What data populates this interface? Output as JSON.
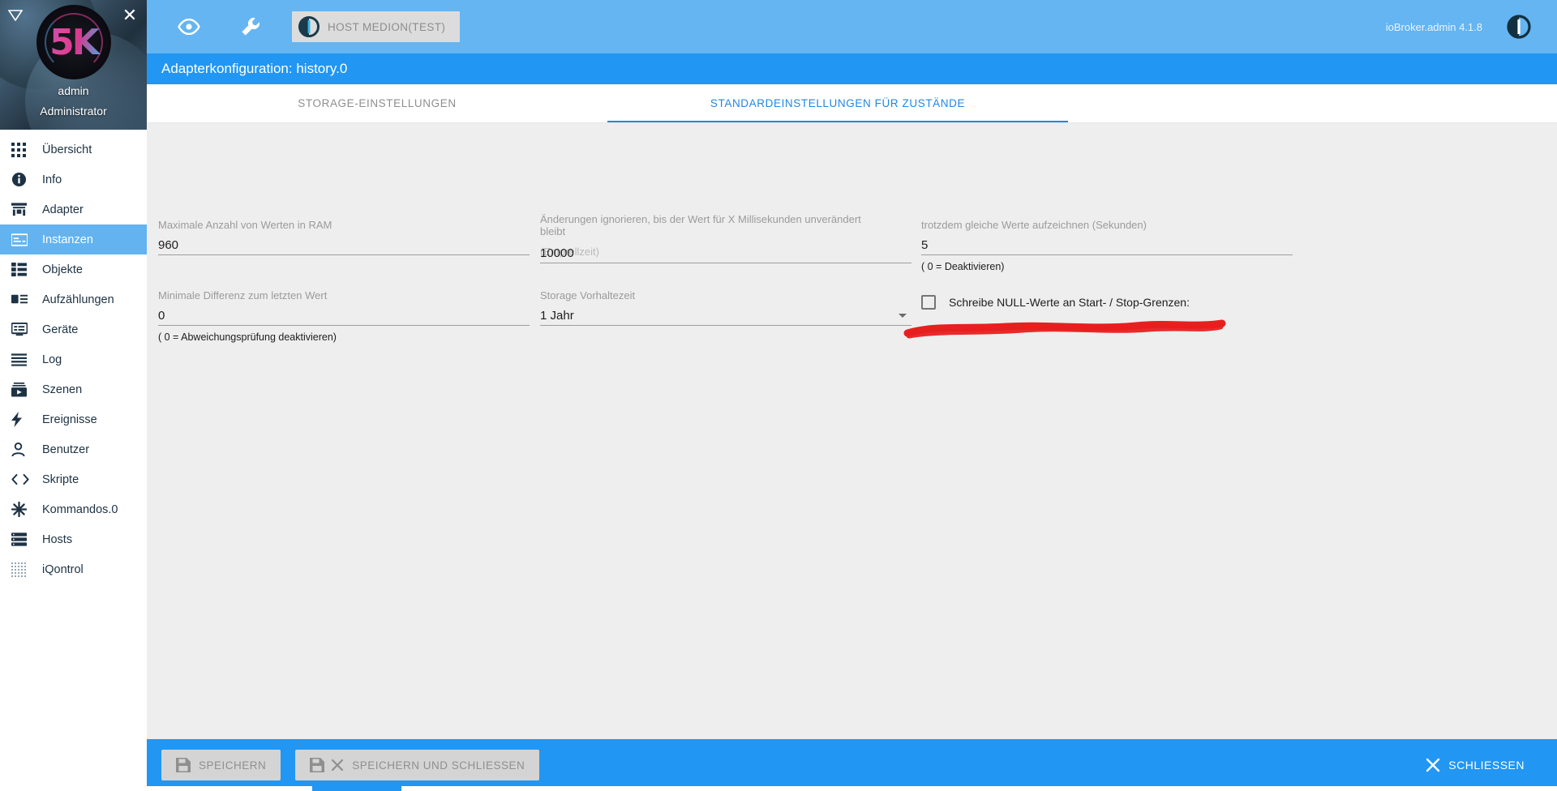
{
  "sidebar": {
    "user": {
      "name": "admin",
      "role": "Administrator",
      "avatar_initials": "5K"
    },
    "collapse_icon": "collapse-triangle-icon",
    "close_icon": "✕",
    "items": [
      {
        "label": "Übersicht",
        "icon": "grid-icon",
        "active": false
      },
      {
        "label": "Info",
        "icon": "info-icon",
        "active": false
      },
      {
        "label": "Adapter",
        "icon": "store-icon",
        "active": false
      },
      {
        "label": "Instanzen",
        "icon": "instances-icon",
        "active": true
      },
      {
        "label": "Objekte",
        "icon": "objects-list-icon",
        "active": false
      },
      {
        "label": "Aufzählungen",
        "icon": "enumerations-icon",
        "active": false
      },
      {
        "label": "Geräte",
        "icon": "devices-icon",
        "active": false
      },
      {
        "label": "Log",
        "icon": "log-lines-icon",
        "active": false
      },
      {
        "label": "Szenen",
        "icon": "scenes-play-icon",
        "active": false
      },
      {
        "label": "Ereignisse",
        "icon": "lightning-bolt-icon",
        "active": false
      },
      {
        "label": "Benutzer",
        "icon": "user-icon",
        "active": false
      },
      {
        "label": "Skripte",
        "icon": "code-brackets-icon",
        "active": false
      },
      {
        "label": "Kommandos.0",
        "icon": "asterisk-icon",
        "active": false
      },
      {
        "label": "Hosts",
        "icon": "server-rack-icon",
        "active": false
      },
      {
        "label": "iQontrol",
        "icon": "dots-grid-icon",
        "active": false
      }
    ]
  },
  "appbar": {
    "eye_icon": "eye-icon",
    "wrench_icon": "wrench-icon",
    "host_chip_label": "HOST MEDION(TEST)",
    "host_chip_logo": "iobroker-logo-icon",
    "version": "ioBroker.admin 4.1.8",
    "power_icon": "iobroker-power-icon"
  },
  "dialog": {
    "title": "Adapterkonfiguration: history.0",
    "tabs": [
      {
        "label": "STORAGE-EINSTELLUNGEN",
        "active": false
      },
      {
        "label": "STANDARDEINSTELLUNGEN FÜR ZUSTÄNDE",
        "active": true
      }
    ]
  },
  "form": {
    "max_ram": {
      "label": "Maximale Anzahl von Werten in RAM",
      "value": "960"
    },
    "debounce": {
      "label": "Änderungen ignorieren, bis der Wert für X Millisekunden unverändert bleibt",
      "hint_overlap": "(Entprellzeit)",
      "value": "10000"
    },
    "same_values": {
      "label": "trotzdem gleiche Werte aufzeichnen (Sekunden)",
      "value": "5",
      "hint": "( 0 = Deaktivieren)"
    },
    "min_diff": {
      "label": "Minimale Differenz zum letzten Wert",
      "value": "0",
      "hint": "( 0 = Abweichungsprüfung deaktivieren)"
    },
    "retention": {
      "label": "Storage Vorhaltezeit",
      "value": "1 Jahr",
      "arrow_icon": "chevron-down-icon"
    },
    "null_values_checkbox": {
      "label": "Schreibe NULL-Werte an Start- / Stop-Grenzen:",
      "checked": false
    }
  },
  "bottombar": {
    "save": {
      "label": "SPEICHERN",
      "icon": "save-disk-icon"
    },
    "save_close": {
      "label": "SPEICHERN UND SCHLIESSEN",
      "icon": "save-disk-icon",
      "icon2": "close-x-icon"
    },
    "close": {
      "label": "SCHLIESSEN",
      "icon": "close-x-icon"
    }
  },
  "annotation": {
    "color": "#e81f1f",
    "type": "red-underline-scribble"
  },
  "colors": {
    "accent": "#2196f3",
    "appbar": "#64b5f2",
    "sidebar_active": "#62b3f0",
    "panel_bg": "#eeeeee"
  }
}
